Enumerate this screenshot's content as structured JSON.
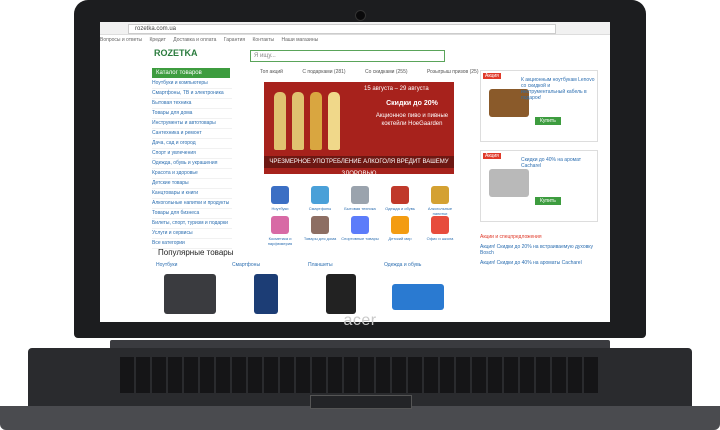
{
  "browser": {
    "url": "rozetka.com.ua"
  },
  "nav": {
    "items": [
      "Вопросы и ответы",
      "Кредит",
      "Доставка и оплата",
      "Гарантия",
      "Контакты",
      "Наши магазины"
    ]
  },
  "header": {
    "brand": "ROZETKA",
    "search_placeholder": "Я ищу..."
  },
  "catalog": {
    "button": "Каталог товаров",
    "items": [
      "Ноутбуки и компьютеры",
      "Смартфоны, ТВ и электроника",
      "Бытовая техника",
      "Товары для дома",
      "Инструменты и автотовары",
      "Сантехника и ремонт",
      "Дача, сад и огород",
      "Спорт и увлечения",
      "Одежда, обувь и украшения",
      "Красота и здоровье",
      "Детские товары",
      "Канцтовары и книги",
      "Алкогольные напитки и продукты",
      "Товары для бизнеса",
      "Билеты, спорт, туризм и подарки",
      "Услуги и сервисы",
      "Все категории"
    ]
  },
  "tabs": [
    "Топ акций",
    "С подарками (281)",
    "Со скидками (255)",
    "Розыгрыш призов (25)"
  ],
  "banner": {
    "tag": "Акция",
    "dates": "15 августа – 29 августа",
    "discount": "Скидки до 20%",
    "subtitle": "Акционное пиво и пивные коктейли HoeGaarden",
    "footer": "ЧРЕЗМЕРНОЕ УПОТРЕБЛЕНИЕ АЛКОГОЛЯ ВРЕДИТ ВАШЕМУ ЗДОРОВЬЮ"
  },
  "tiles": [
    "Ноутбуки",
    "Смартфоны",
    "Бытовая техника",
    "Одежда и обувь",
    "Алкогольные напитки",
    "Косметика и парфюмерия",
    "Товары для дома",
    "Спортивные товары",
    "Детский мир",
    "Офис и школа"
  ],
  "popular": {
    "title": "Популярные товары",
    "cats": [
      "Ноутбуки",
      "Смартфоны",
      "Планшеты",
      "Одежда и обувь"
    ]
  },
  "side": {
    "ad1": {
      "tag": "Акция",
      "text": "К акционным ноутбукам Lenovo со скидкой и инструментальный кабель в подарок!",
      "button": "Купить"
    },
    "ad2": {
      "tag": "Акция",
      "text": "Скидки до 40% на аромат Cacharel",
      "button": "Купить"
    },
    "promos_title": "Акции и спецпредложения",
    "promos": [
      "Акция! Скидки до 20% на встраиваемую духовку Bosch",
      "Акция! Скидки до 40% на ароматы Cacharel"
    ]
  },
  "laptop": {
    "logo": "acer"
  },
  "colors": {
    "brand_green": "#3d9c3f",
    "link_blue": "#2d6fb1",
    "promo_red": "#e03a2a",
    "banner_red": "#a7221c"
  }
}
